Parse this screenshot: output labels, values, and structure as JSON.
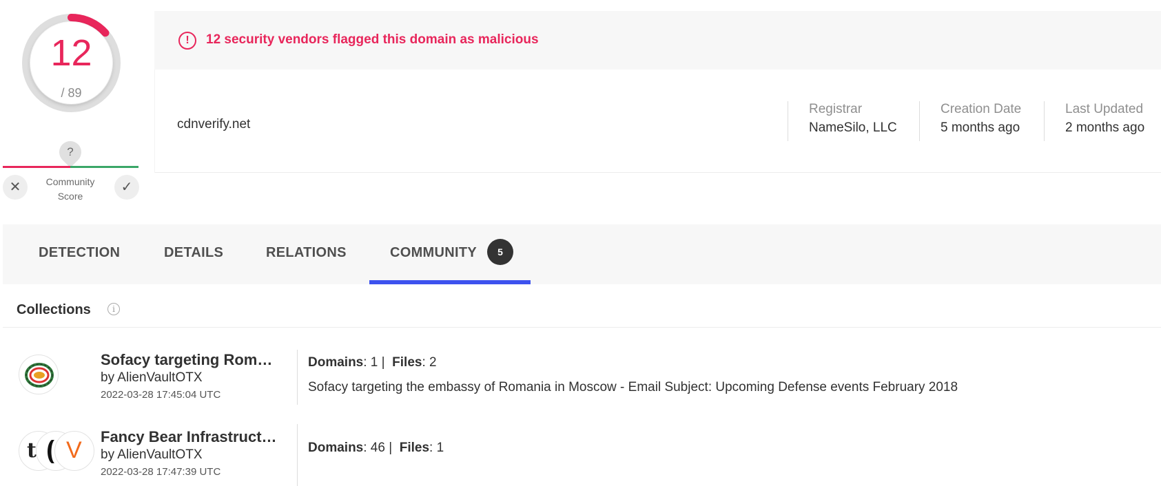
{
  "score": {
    "detections": "12",
    "total": "/ 89",
    "detection_fraction": 0.1348
  },
  "community_score": {
    "question_mark": "?",
    "label": "Community Score",
    "downvote_icon": "x-icon",
    "upvote_icon": "check-icon"
  },
  "alert": {
    "icon": "!",
    "text": "12 security vendors flagged this domain as malicious"
  },
  "domain": "cdnverify.net",
  "meta": [
    {
      "label": "Registrar",
      "value": "NameSilo, LLC"
    },
    {
      "label": "Creation Date",
      "value": "5 months ago"
    },
    {
      "label": "Last Updated",
      "value": "2 months ago"
    }
  ],
  "tabs": [
    {
      "label": "DETECTION"
    },
    {
      "label": "DETAILS"
    },
    {
      "label": "RELATIONS"
    },
    {
      "label": "COMMUNITY",
      "badge": "5",
      "active": true
    }
  ],
  "collections": {
    "title": "Collections",
    "info_icon": "i",
    "items": [
      {
        "name": "Sofacy targeting Romania in Moscow",
        "name_display": "Sofacy targeting Rom…",
        "author": "by AlienVaultOTX",
        "date": "2022-03-28 17:45:04 UTC",
        "domains_label": "Domains",
        "domains_value": ": 1 |",
        "files_label": "Files",
        "files_value": ": 2",
        "description": "Sofacy targeting the embassy of Romania in Moscow - Email Subject: Upcoming Defense events February 2018"
      },
      {
        "name": "Fancy Bear Infrastructure",
        "name_display": "Fancy Bear Infrastruct…",
        "author": "by AlienVaultOTX",
        "date": "2022-03-28 17:47:39 UTC",
        "domains_label": "Domains",
        "domains_value": ": 46 |",
        "files_label": "Files",
        "files_value": ": 1",
        "avatar_letters": [
          "t",
          "V"
        ]
      }
    ]
  },
  "colors": {
    "malicious": "#e8265b",
    "benign": "#3aa667",
    "tab_active": "#3d52ee"
  }
}
